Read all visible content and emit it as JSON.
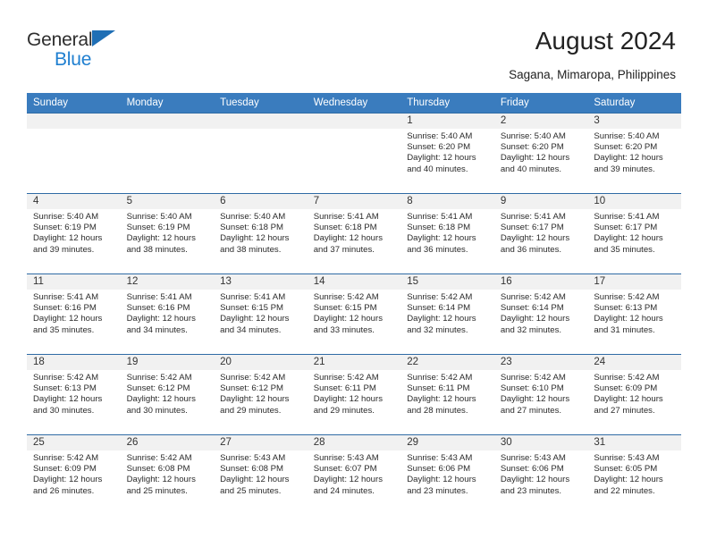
{
  "brand": {
    "name_top": "General",
    "name_bottom": "Blue",
    "triangle_color": "#1f6fb5",
    "blue_text_color": "#1f7fd0"
  },
  "header": {
    "title": "August 2024",
    "location": "Sagana, Mimaropa, Philippines"
  },
  "theme": {
    "header_bg": "#3a7cbe",
    "header_text": "#ffffff",
    "row_rule": "#2f6ba5",
    "daynum_band": "#f1f1f1",
    "body_text": "#2b2b2b"
  },
  "weekday_headers": [
    "Sunday",
    "Monday",
    "Tuesday",
    "Wednesday",
    "Thursday",
    "Friday",
    "Saturday"
  ],
  "labels": {
    "sunrise_prefix": "Sunrise:",
    "sunset_prefix": "Sunset:",
    "daylight_prefix": "Daylight:"
  },
  "weeks": [
    [
      {
        "day": "",
        "line1": "",
        "line2": "",
        "line3": "",
        "line4": ""
      },
      {
        "day": "",
        "line1": "",
        "line2": "",
        "line3": "",
        "line4": ""
      },
      {
        "day": "",
        "line1": "",
        "line2": "",
        "line3": "",
        "line4": ""
      },
      {
        "day": "",
        "line1": "",
        "line2": "",
        "line3": "",
        "line4": ""
      },
      {
        "day": "1",
        "line1": "Sunrise: 5:40 AM",
        "line2": "Sunset: 6:20 PM",
        "line3": "Daylight: 12 hours",
        "line4": "and 40 minutes."
      },
      {
        "day": "2",
        "line1": "Sunrise: 5:40 AM",
        "line2": "Sunset: 6:20 PM",
        "line3": "Daylight: 12 hours",
        "line4": "and 40 minutes."
      },
      {
        "day": "3",
        "line1": "Sunrise: 5:40 AM",
        "line2": "Sunset: 6:20 PM",
        "line3": "Daylight: 12 hours",
        "line4": "and 39 minutes."
      }
    ],
    [
      {
        "day": "4",
        "line1": "Sunrise: 5:40 AM",
        "line2": "Sunset: 6:19 PM",
        "line3": "Daylight: 12 hours",
        "line4": "and 39 minutes."
      },
      {
        "day": "5",
        "line1": "Sunrise: 5:40 AM",
        "line2": "Sunset: 6:19 PM",
        "line3": "Daylight: 12 hours",
        "line4": "and 38 minutes."
      },
      {
        "day": "6",
        "line1": "Sunrise: 5:40 AM",
        "line2": "Sunset: 6:18 PM",
        "line3": "Daylight: 12 hours",
        "line4": "and 38 minutes."
      },
      {
        "day": "7",
        "line1": "Sunrise: 5:41 AM",
        "line2": "Sunset: 6:18 PM",
        "line3": "Daylight: 12 hours",
        "line4": "and 37 minutes."
      },
      {
        "day": "8",
        "line1": "Sunrise: 5:41 AM",
        "line2": "Sunset: 6:18 PM",
        "line3": "Daylight: 12 hours",
        "line4": "and 36 minutes."
      },
      {
        "day": "9",
        "line1": "Sunrise: 5:41 AM",
        "line2": "Sunset: 6:17 PM",
        "line3": "Daylight: 12 hours",
        "line4": "and 36 minutes."
      },
      {
        "day": "10",
        "line1": "Sunrise: 5:41 AM",
        "line2": "Sunset: 6:17 PM",
        "line3": "Daylight: 12 hours",
        "line4": "and 35 minutes."
      }
    ],
    [
      {
        "day": "11",
        "line1": "Sunrise: 5:41 AM",
        "line2": "Sunset: 6:16 PM",
        "line3": "Daylight: 12 hours",
        "line4": "and 35 minutes."
      },
      {
        "day": "12",
        "line1": "Sunrise: 5:41 AM",
        "line2": "Sunset: 6:16 PM",
        "line3": "Daylight: 12 hours",
        "line4": "and 34 minutes."
      },
      {
        "day": "13",
        "line1": "Sunrise: 5:41 AM",
        "line2": "Sunset: 6:15 PM",
        "line3": "Daylight: 12 hours",
        "line4": "and 34 minutes."
      },
      {
        "day": "14",
        "line1": "Sunrise: 5:42 AM",
        "line2": "Sunset: 6:15 PM",
        "line3": "Daylight: 12 hours",
        "line4": "and 33 minutes."
      },
      {
        "day": "15",
        "line1": "Sunrise: 5:42 AM",
        "line2": "Sunset: 6:14 PM",
        "line3": "Daylight: 12 hours",
        "line4": "and 32 minutes."
      },
      {
        "day": "16",
        "line1": "Sunrise: 5:42 AM",
        "line2": "Sunset: 6:14 PM",
        "line3": "Daylight: 12 hours",
        "line4": "and 32 minutes."
      },
      {
        "day": "17",
        "line1": "Sunrise: 5:42 AM",
        "line2": "Sunset: 6:13 PM",
        "line3": "Daylight: 12 hours",
        "line4": "and 31 minutes."
      }
    ],
    [
      {
        "day": "18",
        "line1": "Sunrise: 5:42 AM",
        "line2": "Sunset: 6:13 PM",
        "line3": "Daylight: 12 hours",
        "line4": "and 30 minutes."
      },
      {
        "day": "19",
        "line1": "Sunrise: 5:42 AM",
        "line2": "Sunset: 6:12 PM",
        "line3": "Daylight: 12 hours",
        "line4": "and 30 minutes."
      },
      {
        "day": "20",
        "line1": "Sunrise: 5:42 AM",
        "line2": "Sunset: 6:12 PM",
        "line3": "Daylight: 12 hours",
        "line4": "and 29 minutes."
      },
      {
        "day": "21",
        "line1": "Sunrise: 5:42 AM",
        "line2": "Sunset: 6:11 PM",
        "line3": "Daylight: 12 hours",
        "line4": "and 29 minutes."
      },
      {
        "day": "22",
        "line1": "Sunrise: 5:42 AM",
        "line2": "Sunset: 6:11 PM",
        "line3": "Daylight: 12 hours",
        "line4": "and 28 minutes."
      },
      {
        "day": "23",
        "line1": "Sunrise: 5:42 AM",
        "line2": "Sunset: 6:10 PM",
        "line3": "Daylight: 12 hours",
        "line4": "and 27 minutes."
      },
      {
        "day": "24",
        "line1": "Sunrise: 5:42 AM",
        "line2": "Sunset: 6:09 PM",
        "line3": "Daylight: 12 hours",
        "line4": "and 27 minutes."
      }
    ],
    [
      {
        "day": "25",
        "line1": "Sunrise: 5:42 AM",
        "line2": "Sunset: 6:09 PM",
        "line3": "Daylight: 12 hours",
        "line4": "and 26 minutes."
      },
      {
        "day": "26",
        "line1": "Sunrise: 5:42 AM",
        "line2": "Sunset: 6:08 PM",
        "line3": "Daylight: 12 hours",
        "line4": "and 25 minutes."
      },
      {
        "day": "27",
        "line1": "Sunrise: 5:43 AM",
        "line2": "Sunset: 6:08 PM",
        "line3": "Daylight: 12 hours",
        "line4": "and 25 minutes."
      },
      {
        "day": "28",
        "line1": "Sunrise: 5:43 AM",
        "line2": "Sunset: 6:07 PM",
        "line3": "Daylight: 12 hours",
        "line4": "and 24 minutes."
      },
      {
        "day": "29",
        "line1": "Sunrise: 5:43 AM",
        "line2": "Sunset: 6:06 PM",
        "line3": "Daylight: 12 hours",
        "line4": "and 23 minutes."
      },
      {
        "day": "30",
        "line1": "Sunrise: 5:43 AM",
        "line2": "Sunset: 6:06 PM",
        "line3": "Daylight: 12 hours",
        "line4": "and 23 minutes."
      },
      {
        "day": "31",
        "line1": "Sunrise: 5:43 AM",
        "line2": "Sunset: 6:05 PM",
        "line3": "Daylight: 12 hours",
        "line4": "and 22 minutes."
      }
    ]
  ]
}
